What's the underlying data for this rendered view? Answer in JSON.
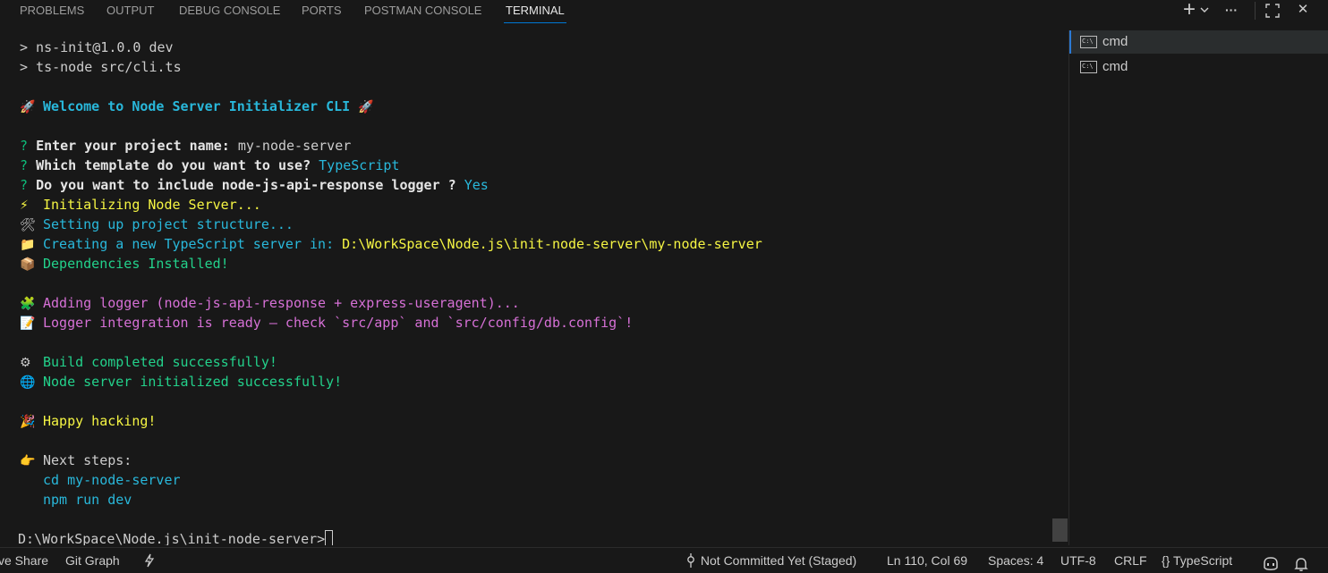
{
  "panel": {
    "tabs": [
      {
        "label": "PROBLEMS",
        "active": false
      },
      {
        "label": "OUTPUT",
        "active": false
      },
      {
        "label": "DEBUG CONSOLE",
        "active": false
      },
      {
        "label": "PORTS",
        "active": false
      },
      {
        "label": "POSTMAN CONSOLE",
        "active": false
      },
      {
        "label": "TERMINAL",
        "active": true
      }
    ],
    "actions": {
      "new_terminal": "+",
      "more": "···",
      "close": "✕"
    }
  },
  "terminal": {
    "lines": {
      "l1": "> ns-init@1.0.0 dev",
      "l2": "> ts-node src/cli.ts",
      "welcome_rocket1": "🚀",
      "welcome_text": "Welcome to Node Server Initializer CLI",
      "welcome_rocket2": "🚀",
      "q_mark": "?",
      "q1_label": "Enter your project name:",
      "q1_answer": "my-node-server",
      "q2_label": "Which template do you want to use?",
      "q2_answer": "TypeScript",
      "q3_label": "Do you want to include node-js-api-response logger ?",
      "q3_answer": "Yes",
      "init_icon": "⚡",
      "init_text": "Initializing Node Server...",
      "setup_icon": "🛠",
      "setup_text": "Setting up project structure...",
      "create_icon": "📁",
      "create_text_a": "Creating a new ",
      "create_text_b": "TypeScript",
      "create_text_c": " server in: ",
      "create_path": "D:\\WorkSpace\\Node.js\\init-node-server\\my-node-server",
      "deps_icon": "📦",
      "deps_text": "Dependencies Installed!",
      "logger_icon": "🧩",
      "logger_text": "Adding logger (node-js-api-response + express-useragent)...",
      "ready_icon": "📝",
      "ready_text": "Logger integration is ready — check `src/app` and `src/config/db.config`!",
      "build_icon": "⚙",
      "build_text": "Build completed successfully!",
      "node_icon": "🌐",
      "node_text": "Node server initialized successfully!",
      "happy_icon": "🎉",
      "happy_text": "Happy hacking!",
      "next_icon": "👉",
      "next_text": "Next steps:",
      "step1": "cd my-node-server",
      "step2": "npm run dev",
      "prompt": "D:\\WorkSpace\\Node.js\\init-node-server>"
    }
  },
  "terminal_list": {
    "items": [
      {
        "label": "cmd",
        "icon": "terminal-cmd-icon",
        "selected": true
      },
      {
        "label": "cmd",
        "icon": "terminal-cmd-icon",
        "selected": false
      }
    ],
    "icon_text": "C:\\"
  },
  "statusbar": {
    "live_share": "ve Share",
    "git_graph": "Git Graph",
    "git_status": "Not Committed Yet (Staged)",
    "position": "Ln 110, Col 69",
    "spaces": "Spaces: 4",
    "encoding": "UTF-8",
    "eol": "CRLF",
    "language_braces": "{}",
    "language": "TypeScript"
  },
  "colors": {
    "background": "#181818",
    "accent": "#0078d4",
    "cyan": "#29b8db",
    "yellow": "#f5f543",
    "green": "#23d18b",
    "magenta": "#d670d6"
  }
}
